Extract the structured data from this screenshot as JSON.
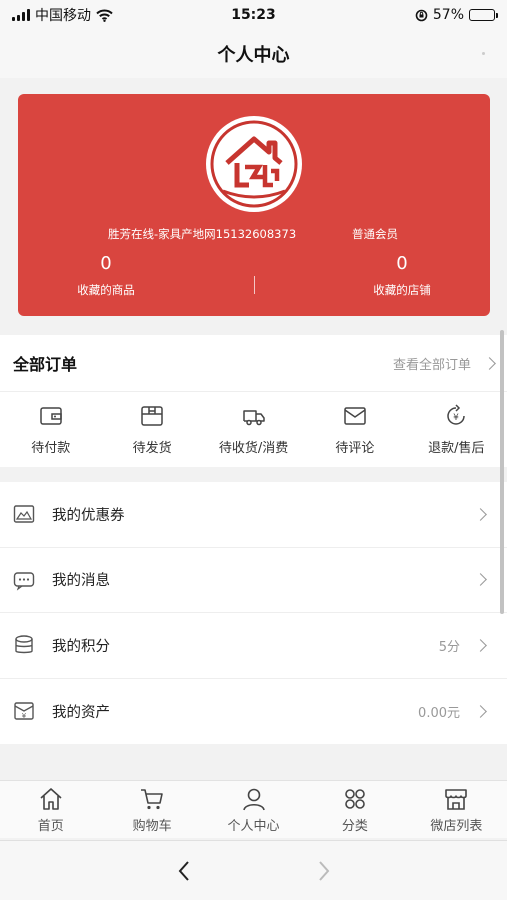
{
  "status_bar": {
    "carrier": "中国移动",
    "time": "15:23",
    "battery_percent": "57%",
    "battery_level": 0.57
  },
  "nav": {
    "title": "个人中心"
  },
  "profile": {
    "name": "胜芳在线-家具产地网15132608373",
    "level": "普通会员",
    "favorite_goods_count": "0",
    "favorite_goods_label": "收藏的商品",
    "favorite_shops_count": "0",
    "favorite_shops_label": "收藏的店铺",
    "card_color": "#d9453f"
  },
  "orders": {
    "title": "全部订单",
    "view_all": "查看全部订单",
    "tabs": [
      {
        "label": "待付款",
        "icon": "wallet-icon"
      },
      {
        "label": "待发货",
        "icon": "box-icon"
      },
      {
        "label": "待收货/消费",
        "icon": "truck-icon"
      },
      {
        "label": "待评论",
        "icon": "envelope-icon"
      },
      {
        "label": "退款/售后",
        "icon": "refund-icon"
      }
    ]
  },
  "menu": [
    {
      "label": "我的优惠券",
      "value": "",
      "icon": "coupon-icon"
    },
    {
      "label": "我的消息",
      "value": "",
      "icon": "message-icon"
    },
    {
      "label": "我的积分",
      "value": "5分",
      "icon": "points-icon"
    },
    {
      "label": "我的资产",
      "value": "0.00元",
      "icon": "assets-icon"
    }
  ],
  "tab_bar": [
    {
      "label": "首页",
      "icon": "home-icon"
    },
    {
      "label": "购物车",
      "icon": "cart-icon"
    },
    {
      "label": "个人中心",
      "icon": "user-icon"
    },
    {
      "label": "分类",
      "icon": "category-icon"
    },
    {
      "label": "微店列表",
      "icon": "store-icon"
    }
  ],
  "browser": {
    "back_icon": "chevron-left-icon",
    "forward_icon": "chevron-right-icon"
  }
}
